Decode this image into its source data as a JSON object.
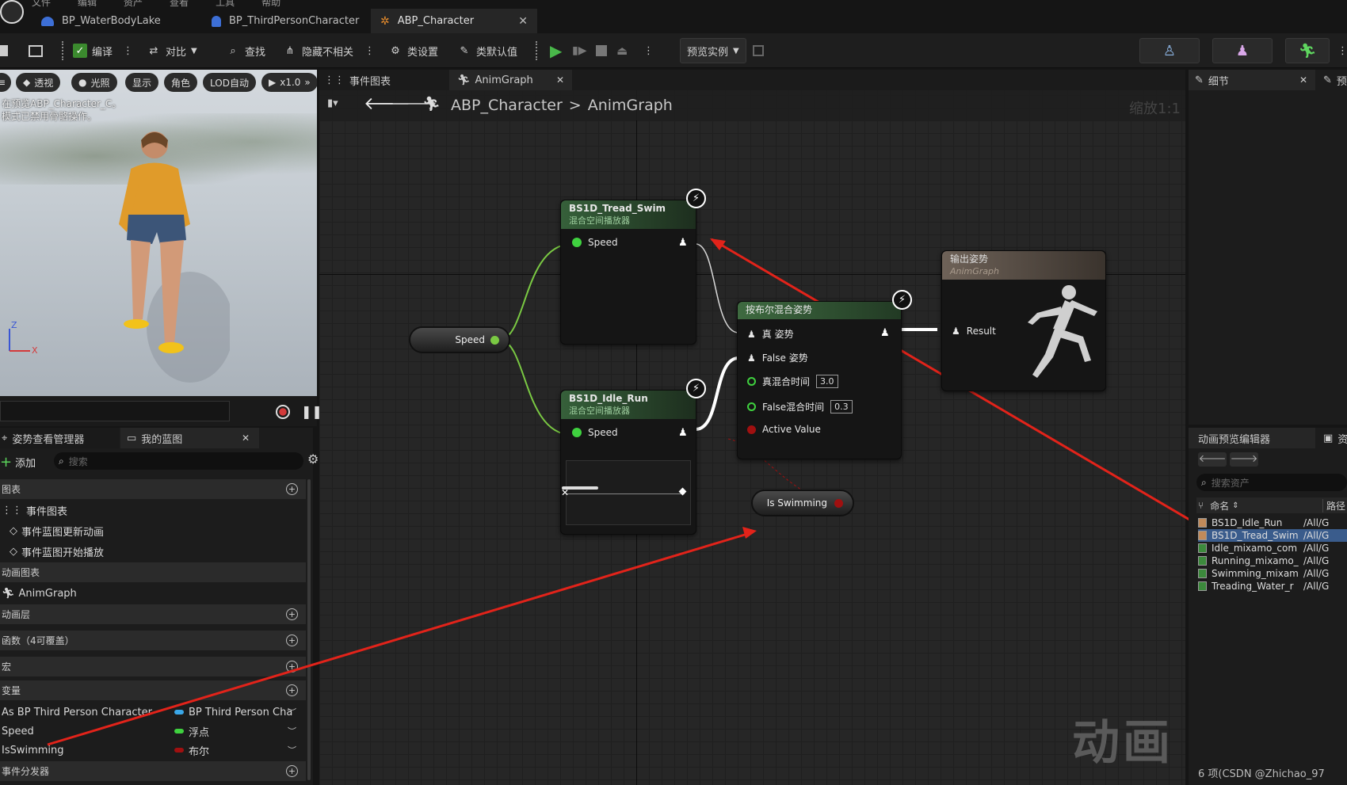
{
  "window": {
    "menu_items": [
      "文件",
      "编辑",
      "资产",
      "查看",
      "工具",
      "帮助"
    ],
    "tabs": [
      {
        "label": "BP_WaterBodyLake",
        "icon": "water-body-icon"
      },
      {
        "label": "BP_ThirdPersonCharacter",
        "icon": "character-blueprint-icon"
      },
      {
        "label": "ABP_Character",
        "icon": "anim-blueprint-icon",
        "active": true
      }
    ]
  },
  "toolbar": {
    "compile": "编译",
    "diff": "对比",
    "find": "查找",
    "hide_unrelated": "隐藏不相关",
    "class_settings": "类设置",
    "class_defaults": "类默认值",
    "preview_instance": "预览实例"
  },
  "viewport": {
    "chips": [
      "透视",
      "光照",
      "显示",
      "角色",
      "LOD自动",
      "x1.0"
    ],
    "message_line1": "在预览ABP_Character_C。",
    "message_line2": "模式已禁用骨骼操作。",
    "axis_z": "Z",
    "axis_x": "X"
  },
  "left_panel": {
    "tab_pose": "姿势查看管理器",
    "tab_mybp": "我的蓝图",
    "add": "添加",
    "search_placeholder": "搜索",
    "sections": {
      "graphs": "图表",
      "anim_graphs": "动画图表",
      "anim_layers": "动画层",
      "functions": "函数（4可覆盖）",
      "macros": "宏",
      "variables": "变量",
      "dispatchers": "事件分发器"
    },
    "graph_items": {
      "event_graph": "事件图表",
      "update_anim": "事件蓝图更新动画",
      "begin_play": "事件蓝图开始播放"
    },
    "anim_graph_item": "AnimGraph",
    "variables": [
      {
        "name": "As BP Third Person Character",
        "type": "BP Third Person Cha",
        "color": "#3aa7e8"
      },
      {
        "name": "Speed",
        "type": "浮点",
        "color": "#3fd13f"
      },
      {
        "name": "IsSwimming",
        "type": "布尔",
        "color": "#a01010"
      }
    ]
  },
  "graph": {
    "tab_event_graph": "事件图表",
    "tab_animgraph": "AnimGraph",
    "breadcrumb_root": "ABP_Character",
    "breadcrumb_sep": ">",
    "breadcrumb_leaf": "AnimGraph",
    "zoom": "缩放1:1",
    "watermark": "动画",
    "speed_getter": "Speed",
    "is_swimming_getter": "Is Swimming",
    "node_tread": {
      "title": "BS1D_Tread_Swim",
      "subtitle": "混合空间播放器",
      "pin": "Speed"
    },
    "node_idle": {
      "title": "BS1D_Idle_Run",
      "subtitle": "混合空间播放器",
      "pin": "Speed"
    },
    "node_blend": {
      "title": "按布尔混合姿势",
      "true_pose": "真 姿势",
      "false_pose": "False 姿势",
      "true_time_label": "真混合时间",
      "true_time": "3.0",
      "false_time_label": "False混合时间",
      "false_time": "0.3",
      "active": "Active Value"
    },
    "node_output": {
      "title": "输出姿势",
      "subtitle": "AnimGraph",
      "result": "Result"
    }
  },
  "details": {
    "tab": "细节",
    "tab2": "预"
  },
  "asset_panel": {
    "tab": "动画预览编辑器",
    "tab2": "资",
    "search_placeholder": "搜索资产",
    "col_name": "命名",
    "col_path": "路径",
    "assets": [
      {
        "name": "BS1D_Idle_Run",
        "path": "/All/G",
        "kind": "blendspace"
      },
      {
        "name": "BS1D_Tread_Swim",
        "path": "/All/G",
        "kind": "blendspace",
        "selected": true
      },
      {
        "name": "Idle_mixamo_com",
        "path": "/All/G",
        "kind": "anim"
      },
      {
        "name": "Running_mixamo_",
        "path": "/All/G",
        "kind": "anim"
      },
      {
        "name": "Swimming_mixamo",
        "path": "/All/G",
        "kind": "anim"
      },
      {
        "name": "Treading_Water_r",
        "path": "/All/G",
        "kind": "anim"
      }
    ],
    "footer": "6 项(CSDN @Zhichao_97"
  }
}
